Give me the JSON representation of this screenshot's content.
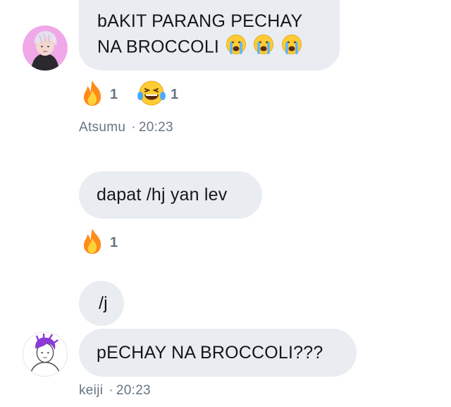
{
  "group1": {
    "message_line1": "bAKIT PARANG PECHAY",
    "message_line2": "NA BROCCOLI",
    "reactions": [
      {
        "icon": "fire-icon",
        "count": "1"
      },
      {
        "icon": "laughing-tears-icon",
        "count": "1"
      }
    ],
    "sender": "Atsumu",
    "time": "20:23"
  },
  "group2": {
    "message1": "dapat /hj yan lev",
    "reaction": {
      "icon": "fire-icon",
      "count": "1"
    },
    "message2": "/j",
    "message3": "pECHAY NA BROCCOLI???",
    "sender": "keiji",
    "time": "20:23"
  },
  "colors": {
    "bubble": "#e9edf1",
    "meta_text": "#687582",
    "message_text": "#14171a"
  }
}
